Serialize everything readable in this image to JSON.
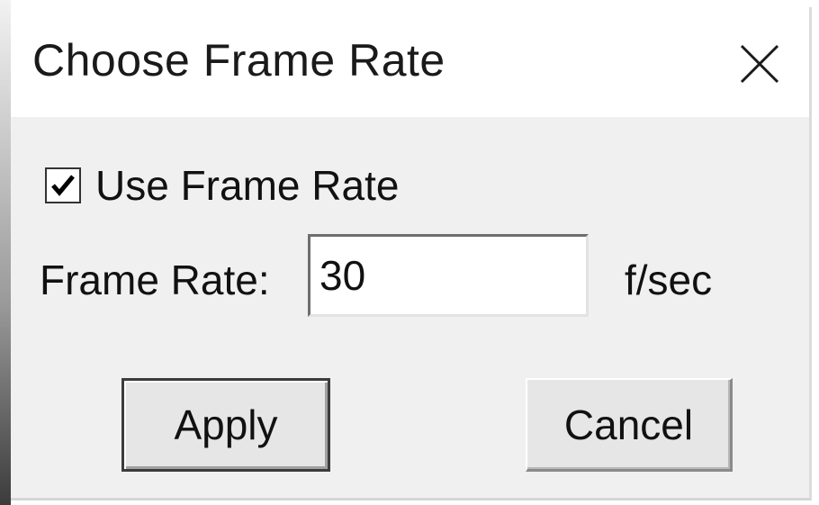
{
  "dialog": {
    "title": "Choose Frame Rate",
    "close_icon": "close-icon"
  },
  "use_frame_rate": {
    "label": "Use Frame Rate",
    "checked": true,
    "icon": "checkmark-icon"
  },
  "frame_rate": {
    "label": "Frame Rate:",
    "value": "30",
    "unit": "f/sec"
  },
  "buttons": {
    "apply": "Apply",
    "cancel": "Cancel"
  }
}
